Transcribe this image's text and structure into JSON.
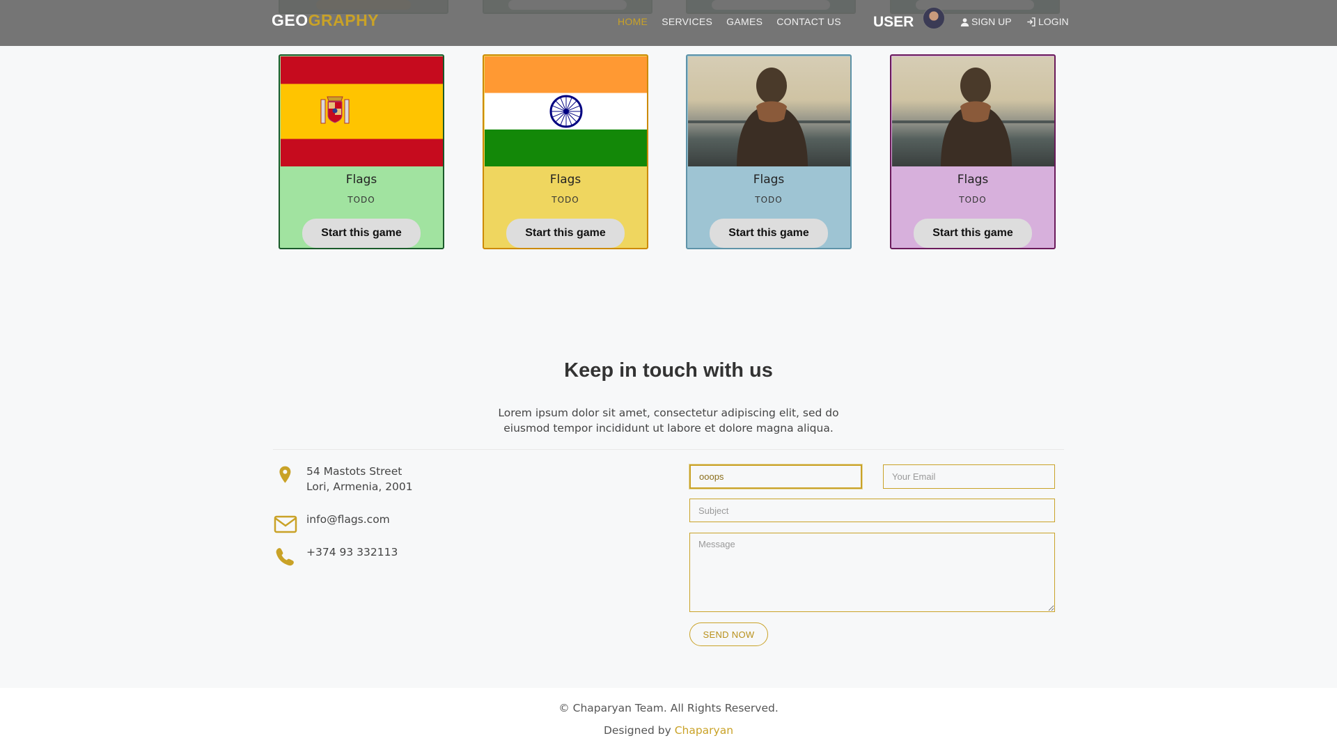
{
  "header": {
    "brand_part1": "GEO",
    "brand_part2": "GRAPHY",
    "nav": [
      "HOME",
      "SERVICES",
      "GAMES",
      "CONTACT US"
    ],
    "active_nav": "HOME",
    "user_label": "USER",
    "signup": "SIGN UP",
    "login": "LOGIN"
  },
  "cards": [
    {
      "title": "Flags",
      "subtitle": "TODO",
      "button": "Start this game",
      "image": "spain-flag",
      "bg": "#a1e3a0",
      "border": "#1a5a2a"
    },
    {
      "title": "Flags",
      "subtitle": "TODO",
      "button": "Start this game",
      "image": "india-flag",
      "bg": "#efd65f",
      "border": "#cc8a00"
    },
    {
      "title": "Flags",
      "subtitle": "TODO",
      "button": "Start this game",
      "image": "person-photo",
      "bg": "#9ec4d3",
      "border": "#5e93a8"
    },
    {
      "title": "Flags",
      "subtitle": "TODO",
      "button": "Start this game",
      "image": "person-photo",
      "bg": "#d7b0dc",
      "border": "#6a1a5a"
    }
  ],
  "contact": {
    "title": "Keep in touch with us",
    "text": "Lorem ipsum dolor sit amet, consectetur adipiscing elit, sed do eiusmod tempor incididunt ut labore et dolore magna aliqua.",
    "address_line1": "54 Mastots Street",
    "address_line2": "Lori, Armenia, 2001",
    "email": "info@flags.com",
    "phone": "+374 93 332113",
    "form": {
      "name_value": "ooops",
      "email_placeholder": "Your Email",
      "subject_placeholder": "Subject",
      "message_placeholder": "Message",
      "send_label": "SEND NOW"
    }
  },
  "footer": {
    "copyright": "© Chaparyan Team. All Rights Reserved.",
    "designed_prefix": "Designed by ",
    "designed_link": "Chaparyan"
  },
  "colors": {
    "accent": "#c9a227",
    "header_bg": "#696969"
  }
}
